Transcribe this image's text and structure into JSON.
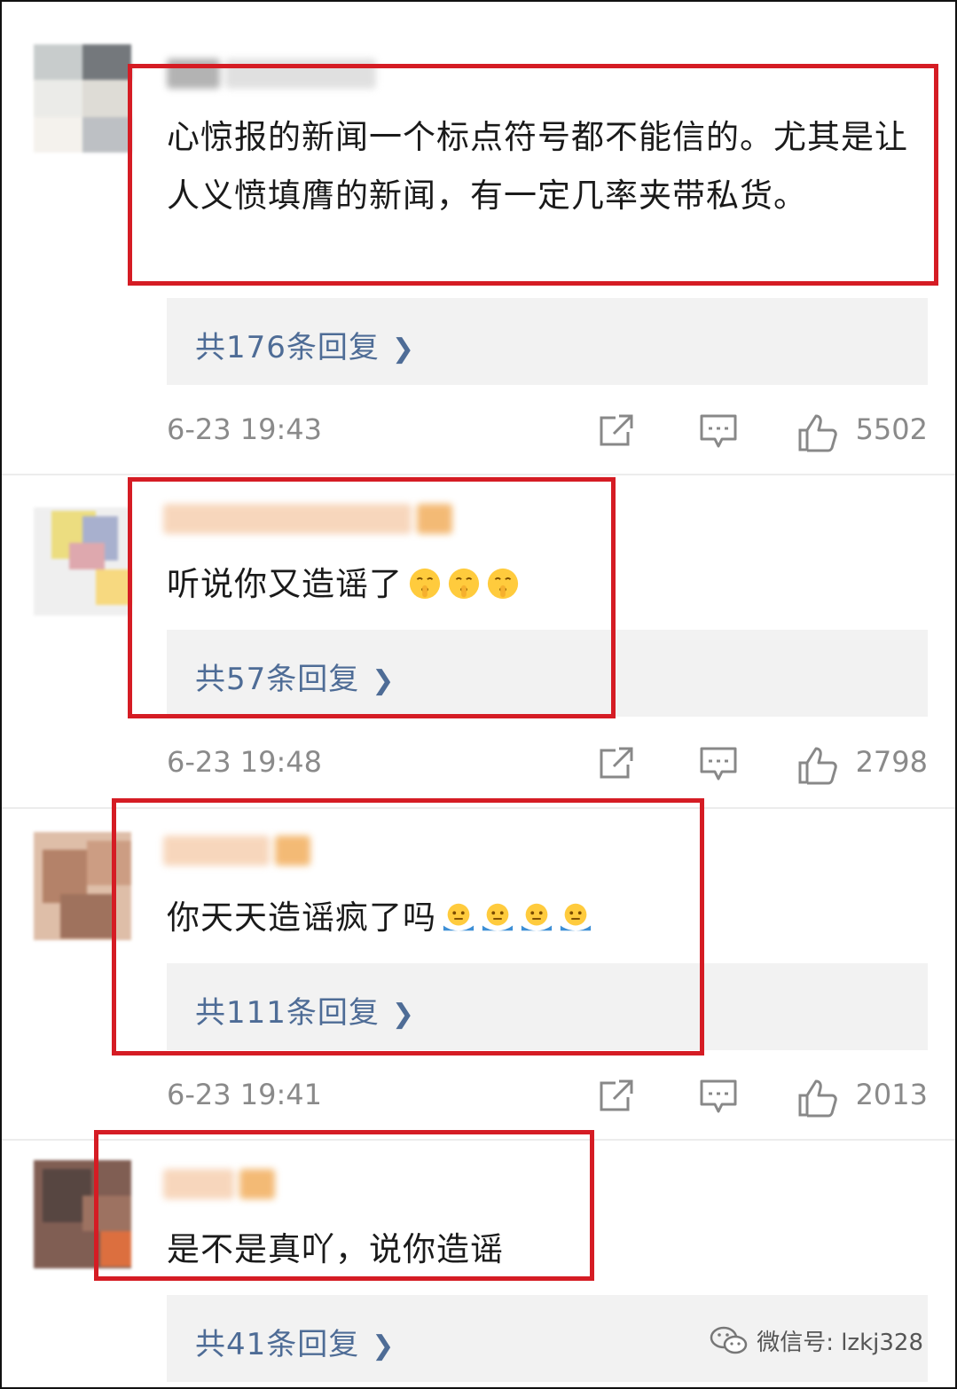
{
  "comments": [
    {
      "text": "心惊报的新闻一个标点符号都不能信的。尤其是让人义愤填膺的新闻，有一定几率夹带私货。",
      "replies": "共176条回复",
      "time": "6-23 19:43",
      "likes": "5502"
    },
    {
      "text": "听说你又造谣了",
      "emoji": "shushing-face",
      "replies": "共57条回复",
      "time": "6-23 19:48",
      "likes": "2798"
    },
    {
      "text": "你天天造谣疯了吗",
      "emoji": "shrugging-face",
      "replies": "共111条回复",
      "time": "6-23 19:41",
      "likes": "2013"
    },
    {
      "text": "是不是真吖，说你造谣",
      "replies": "共41条回复"
    }
  ],
  "watermark": "微信号: lzkj328",
  "highlight_color": "#d51c24",
  "link_color": "#4e6c96"
}
